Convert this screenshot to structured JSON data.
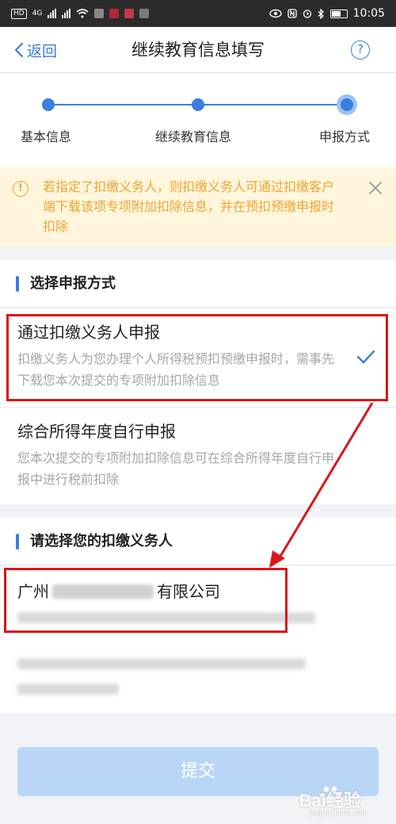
{
  "status_bar": {
    "time": "10:05",
    "network_label": "HD",
    "signal_label": "4G",
    "battery_icon": "battery-icon"
  },
  "header": {
    "back_label": "返回",
    "title": "继续教育信息填写",
    "help_label": "?"
  },
  "steps": [
    {
      "label": "基本信息"
    },
    {
      "label": "继续教育信息"
    },
    {
      "label": "申报方式"
    }
  ],
  "notice": {
    "icon": "!",
    "text": "若指定了扣缴义务人，则扣缴义务人可通过扣缴客户端下载该项专项附加扣除信息，并在预扣预缴申报时扣除"
  },
  "section_method": {
    "title": "选择申报方式"
  },
  "options": [
    {
      "title": "通过扣缴义务人申报",
      "desc": "扣缴义务人为您办理个人所得税预扣预缴申报时，需事先下载您本次提交的专项附加扣除信息",
      "selected": true
    },
    {
      "title": "综合所得年度自行申报",
      "desc": "您本次提交的专项附加扣除信息可在综合所得年度自行申报中进行税前扣除",
      "selected": false
    }
  ],
  "section_withholder": {
    "title": "请选择您的扣缴义务人"
  },
  "withholder": {
    "name_prefix": "广州",
    "name_suffix": "有限公司"
  },
  "submit": {
    "label": "提交"
  },
  "watermark": {
    "text": "Bai经验",
    "sub": "jingyan.baidu.com"
  },
  "colors": {
    "primary": "#3a7ee0",
    "notice_bg": "#fff6dd",
    "notice_text": "#f0a431",
    "highlight": "#d9151b",
    "submit_disabled": "#b9d6f7"
  }
}
